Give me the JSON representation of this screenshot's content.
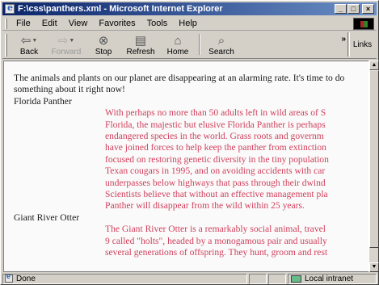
{
  "window": {
    "title": "F:\\css\\panthers.xml - Microsoft Internet Explorer"
  },
  "title_buttons": {
    "minimize": "_",
    "maximize": "□",
    "close": "×"
  },
  "menu": [
    {
      "label": "File"
    },
    {
      "label": "Edit"
    },
    {
      "label": "View"
    },
    {
      "label": "Favorites"
    },
    {
      "label": "Tools"
    },
    {
      "label": "Help"
    }
  ],
  "toolbar": {
    "back": "Back",
    "forward": "Forward",
    "stop": "Stop",
    "refresh": "Refresh",
    "home": "Home",
    "search": "Search",
    "chevron": "»",
    "links": "Links"
  },
  "icons": {
    "back": "arrow-left-icon",
    "forward": "arrow-right-icon",
    "stop": "stop-icon",
    "refresh": "refresh-icon",
    "home": "home-icon",
    "search": "search-icon"
  },
  "content": {
    "intro": "The animals and plants on our planet are disappearing at an alarming rate. It's time to do something about it right now!",
    "animals": [
      {
        "name": "Florida Panther",
        "lines": [
          "With perhaps no more than 50 adults left in wild areas of S",
          "Florida, the majestic but elusive Florida Panther is perhaps",
          "endangered species in the world. Grass roots and governm",
          "have joined forces to help keep the panther from extinction",
          "focused on restoring genetic diversity in the tiny population",
          "Texan cougars in 1995, and on avoiding accidents with car",
          "underpasses below highways that pass through their dwind",
          "Scientists believe that without an effective management pla",
          "Panther will disappear from the wild within 25 years."
        ]
      },
      {
        "name": "Giant River Otter",
        "lines": [
          "The Giant River Otter  is a remarkably social animal, travel",
          "9 called \"holts\", headed by a monogamous pair and usually",
          "several generations of offspring. They hunt, groom and rest"
        ]
      }
    ]
  },
  "status": {
    "text": "Done",
    "zone": "Local intranet"
  },
  "colors": {
    "accent_text": "#d0405c",
    "titlebar": "#0a246a"
  }
}
